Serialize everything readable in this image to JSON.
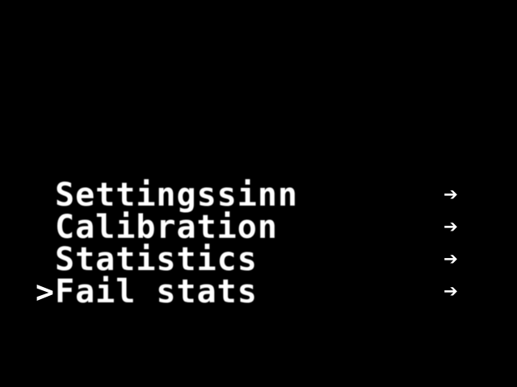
{
  "menu": {
    "items": [
      {
        "label": "Settingssinn",
        "cursor": "",
        "arrow": "➔"
      },
      {
        "label": "Calibration",
        "cursor": "",
        "arrow": "➔"
      },
      {
        "label": "Statistics",
        "cursor": "",
        "arrow": "➔"
      },
      {
        "label": "Fail stats",
        "cursor": ">",
        "arrow": "➔"
      }
    ]
  },
  "colors": {
    "background": "#000000",
    "text": "#ffffff"
  },
  "icons": {
    "arrow": "arrow-right-icon",
    "cursor": "selection-cursor-icon"
  }
}
